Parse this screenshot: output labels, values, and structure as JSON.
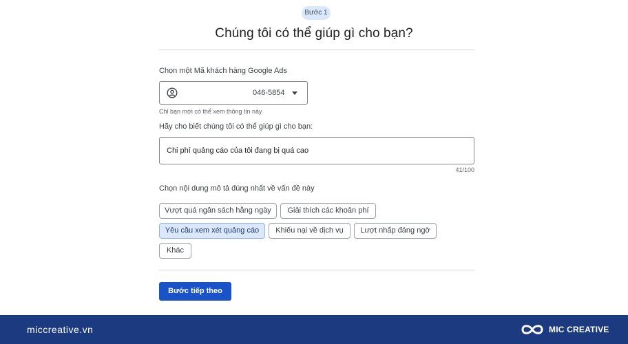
{
  "step": {
    "label": "Bước 1"
  },
  "page": {
    "title": "Chúng tôi có thể giúp gì cho bạn?"
  },
  "account": {
    "label": "Chọn một Mã khách hàng Google Ads",
    "selected_value": "046-5854",
    "helper": "Chỉ bạn mới có thể xem thông tin này",
    "icon": "account-circle-icon"
  },
  "help": {
    "label": "Hãy cho biết chúng tôi có thể giúp gì cho bạn:",
    "value": "Chi phí quảng cáo của tôi đang bị quá cao",
    "counter": "41/100"
  },
  "category": {
    "label": "Chọn nội dung mô tả đúng nhất về vấn đề này",
    "options": [
      {
        "label": "Vượt quá ngân sách hằng ngày",
        "selected": false
      },
      {
        "label": "Giải thích các khoản phí",
        "selected": false
      },
      {
        "label": "Yêu cầu xem xét quảng cáo",
        "selected": true
      },
      {
        "label": "Khiếu nại về dịch vụ",
        "selected": false
      },
      {
        "label": "Lượt nhấp đáng ngờ",
        "selected": false
      },
      {
        "label": "Khác",
        "selected": false
      }
    ]
  },
  "actions": {
    "next_label": "Bước tiếp theo"
  },
  "footer": {
    "site": "miccreative.vn",
    "brand": "MIC CREATIVE",
    "logo_icon": "infinity-logo-icon"
  },
  "colors": {
    "primary": "#1a53c8",
    "chip_selected_bg": "#dbe7fb",
    "footer_bg": "#1c3a80"
  }
}
